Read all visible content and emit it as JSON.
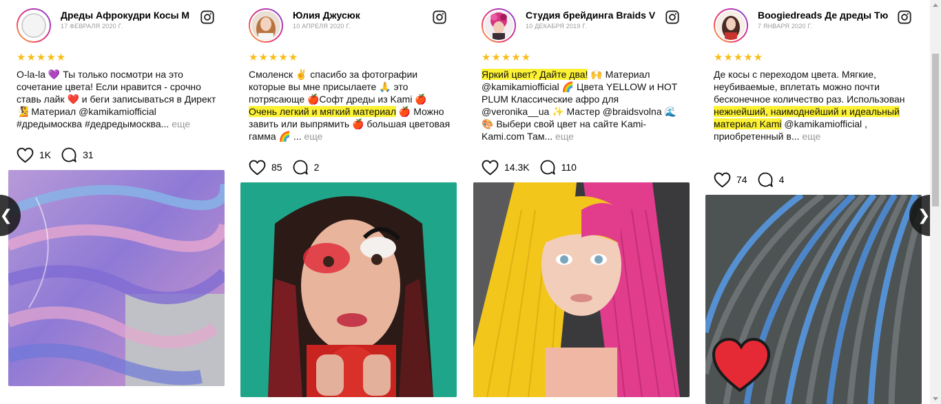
{
  "rating": "★★★★★",
  "more_label": "еще",
  "nav": {
    "prev_icon": "chevron-left-icon",
    "next_icon": "chevron-right-icon"
  },
  "colors": {
    "star": "#f7bd1b",
    "highlight": "#fcf233",
    "muted": "#999999"
  },
  "posts": [
    {
      "author": "Дреды Афрокудри Косы М",
      "date": "17 ФЕВРАЛЯ 2020 Г.",
      "text": "O-la-la 💜 Ты только посмотри на это сочетание цвета! Если нравится - срочно ставь лайк ❤️ и беги записываться в Директ 🧏 Материал @kamikamiofficial #дредымосква #дедредымосква...",
      "likes": "1K",
      "comments": "31"
    },
    {
      "author": "Юлия Джусюк",
      "date": "10 АПРЕЛЯ 2020 Г.",
      "text_before": "Смоленск ✌️ спасибо за фотографии которые вы мне присылаете 🙏 это потрясающе 🍎Софт дреды из Kami 🍎",
      "text_highlight": "Очень легкий и мягкий материал",
      "text_after": "🍎 Можно завить или выпрямить 🍎 большая цветовая гамма 🌈 ...",
      "likes": "85",
      "comments": "2"
    },
    {
      "author": "Студия брейдинга Braids V",
      "date": "10 ДЕКАБРЯ 2019 Г.",
      "text_highlight": "Яркий цвет? Дайте два!",
      "text_after": "🙌 Материал @kamikamiofficial 🌈 Цвета YELLOW и HOT PLUM Классические афро для @veronika__ua ✨ Мастер @braidsvolna 🌊 🎨 Выбери свой цвет на сайте Kami-Kami.com Там...",
      "likes": "14.3K",
      "comments": "110"
    },
    {
      "author": "Boogiedreads Де дреды Тю",
      "date": "7 ЯНВАРЯ 2020 Г.",
      "text_before": "Де косы с переходом цвета. Мягкие, неубиваемые, вплетать можно почти бесконечное количество раз. Использован",
      "text_highlight": "нежнейший, наимоднейший и идеальный материал Kami",
      "text_after": "@kamikamiofficial , приобретенный в...",
      "likes": "74",
      "comments": "4"
    }
  ]
}
